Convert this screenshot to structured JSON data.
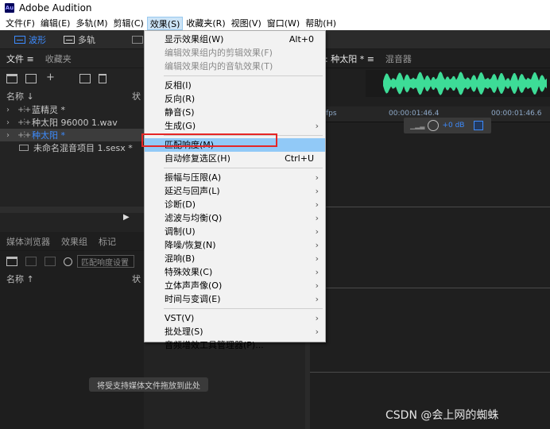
{
  "window": {
    "app_badge": "Au",
    "title": "Adobe Audition"
  },
  "menubar": [
    "文件(F)",
    "编辑(E)",
    "多轨(M)",
    "剪辑(C)",
    "效果(S)",
    "收藏夹(R)",
    "视图(V)",
    "窗口(W)",
    "帮助(H)"
  ],
  "toolbar": {
    "waveform_label": "波形",
    "multitrack_label": "多轨"
  },
  "files_panel": {
    "tabs": [
      "文件",
      "收藏夹"
    ],
    "name_header": "名称 ↓",
    "status_header": "状",
    "items": [
      {
        "name": "蓝精灵 *",
        "type": "wave"
      },
      {
        "name": "种太阳 96000 1.wav",
        "type": "wave"
      },
      {
        "name": "种太阳 *",
        "type": "wave",
        "selected": true
      },
      {
        "name": "未命名混音项目 1.sesx *",
        "type": "session"
      }
    ]
  },
  "media_panel": {
    "tabs": [
      "媒体浏览器",
      "效果组",
      "标记"
    ],
    "search_placeholder": "匹配响度设置",
    "name_header": "名称 ↑",
    "status_header": "状",
    "drop_hint": "将受支持媒体文件拖放到此处"
  },
  "editor": {
    "tab_label": "器: 种太阳 *",
    "mixer_tab": "混音器",
    "ruler": [
      "fps",
      "00:00:01:46.4",
      "00:00:01:46.6"
    ],
    "hud_db": "+0 dB"
  },
  "effects_menu": {
    "items": [
      {
        "label": "显示效果组(W)",
        "shortcut": "Alt+0"
      },
      {
        "label": "编辑效果组内的剪辑效果(F)",
        "disabled": true
      },
      {
        "label": "编辑效果组内的音轨效果(T)",
        "disabled": true
      },
      {
        "separator": true
      },
      {
        "label": "反相(I)"
      },
      {
        "label": "反向(R)"
      },
      {
        "label": "静音(S)"
      },
      {
        "label": "生成(G)",
        "submenu": true
      },
      {
        "separator": true
      },
      {
        "label": "匹配响度(M)",
        "highlighted": true
      },
      {
        "label": "自动修复选区(H)",
        "shortcut": "Ctrl+U"
      },
      {
        "separator": true
      },
      {
        "label": "振幅与压限(A)",
        "submenu": true
      },
      {
        "label": "延迟与回声(L)",
        "submenu": true
      },
      {
        "label": "诊断(D)",
        "submenu": true
      },
      {
        "label": "滤波与均衡(Q)",
        "submenu": true
      },
      {
        "label": "调制(U)",
        "submenu": true
      },
      {
        "label": "降噪/恢复(N)",
        "submenu": true
      },
      {
        "label": "混响(B)",
        "submenu": true
      },
      {
        "label": "特殊效果(C)",
        "submenu": true
      },
      {
        "label": "立体声声像(O)",
        "submenu": true
      },
      {
        "label": "时间与变调(E)",
        "submenu": true
      },
      {
        "separator": true
      },
      {
        "label": "VST(V)",
        "submenu": true
      },
      {
        "label": "批处理(S)",
        "submenu": true
      },
      {
        "label": "音频增效工具管理器(P)..."
      }
    ]
  },
  "watermark": "CSDN @会上网的蜘蛛",
  "colors": {
    "accent": "#3d8bfd",
    "waveform": "#3ddc97",
    "menu_highlight": "#91c9f7",
    "annotation_red": "#e52626"
  }
}
